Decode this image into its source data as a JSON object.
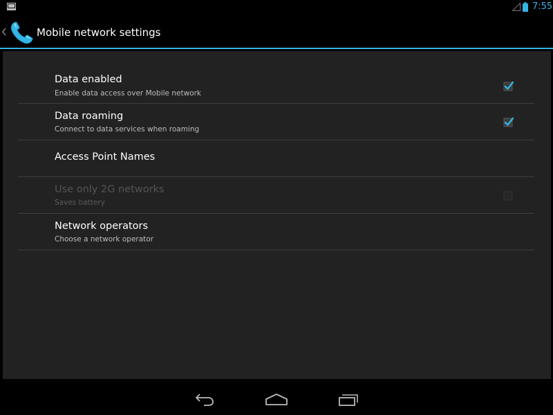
{
  "status_bar": {
    "time": "7:55",
    "left_icon": "tablet-icon",
    "signal_icon": "signal-icon",
    "battery_icon": "battery-icon",
    "accent_color": "#33b5e5"
  },
  "action_bar": {
    "title": "Mobile network settings",
    "app_icon": "phone-icon",
    "up_icon": "chevron-left-icon"
  },
  "preferences": [
    {
      "title": "Data enabled",
      "summary": "Enable data access over Mobile network",
      "checkbox": true,
      "checked": true,
      "enabled": true
    },
    {
      "title": "Data roaming",
      "summary": "Connect to data services when roaming",
      "checkbox": true,
      "checked": true,
      "enabled": true
    },
    {
      "title": "Access Point Names",
      "summary": "",
      "checkbox": false,
      "enabled": true
    },
    {
      "title": "Use only 2G networks",
      "summary": "Saves battery",
      "checkbox": true,
      "checked": false,
      "enabled": false
    },
    {
      "title": "Network operators",
      "summary": "Choose a network operator",
      "checkbox": false,
      "enabled": true
    }
  ],
  "nav_bar": {
    "back_icon": "back-icon",
    "home_icon": "home-icon",
    "recents_icon": "recents-icon"
  },
  "colors": {
    "accent": "#33b5e5",
    "panel_background": "#222222",
    "background": "#000000"
  }
}
